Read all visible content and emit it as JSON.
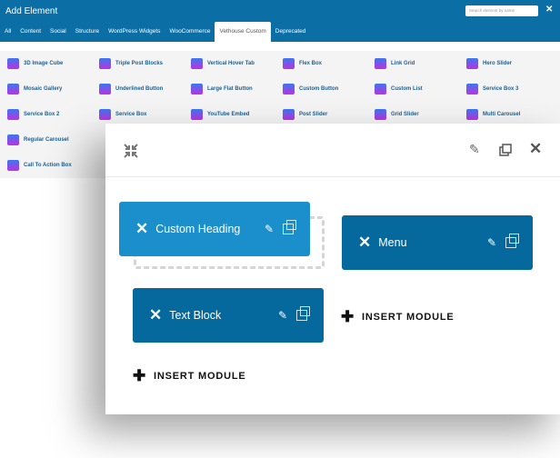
{
  "dialog": {
    "title": "Add Element",
    "search_placeholder": "Search element by name",
    "close": "✕"
  },
  "tabs": [
    {
      "label": "All"
    },
    {
      "label": "Content"
    },
    {
      "label": "Social"
    },
    {
      "label": "Structure"
    },
    {
      "label": "WordPress Widgets"
    },
    {
      "label": "WooCommerce"
    },
    {
      "label": "Vethouse Custom",
      "active": true
    },
    {
      "label": "Deprecated"
    }
  ],
  "elements": [
    "3D Image Cube",
    "Triple Post Blocks",
    "Vertical Hover Tab",
    "Flex Box",
    "Link Grid",
    "Hero Slider",
    "Mosaic Gallery",
    "Underlined Button",
    "Large Flat Button",
    "Custom Button",
    "Custom List",
    "Service Box 3",
    "Service Box 2",
    "Service Box",
    "YouTube Embed",
    "Post Slider",
    "Grid Slider",
    "Multi Carousel",
    "Regular Carousel",
    "",
    "",
    "",
    "",
    "",
    "Call To Action Box"
  ],
  "builder": {
    "icons": {
      "expand": "collapse-arrows-icon",
      "edit": "pencil-icon",
      "copy": "copy-icon",
      "close": "close-icon"
    },
    "modules": [
      {
        "label": "Custom Heading",
        "color": "#1b8fcc"
      },
      {
        "label": "Menu",
        "color": "#06699e"
      },
      {
        "label": "Text Block",
        "color": "#06699e"
      }
    ],
    "insert_label": "INSERT MODULE"
  }
}
